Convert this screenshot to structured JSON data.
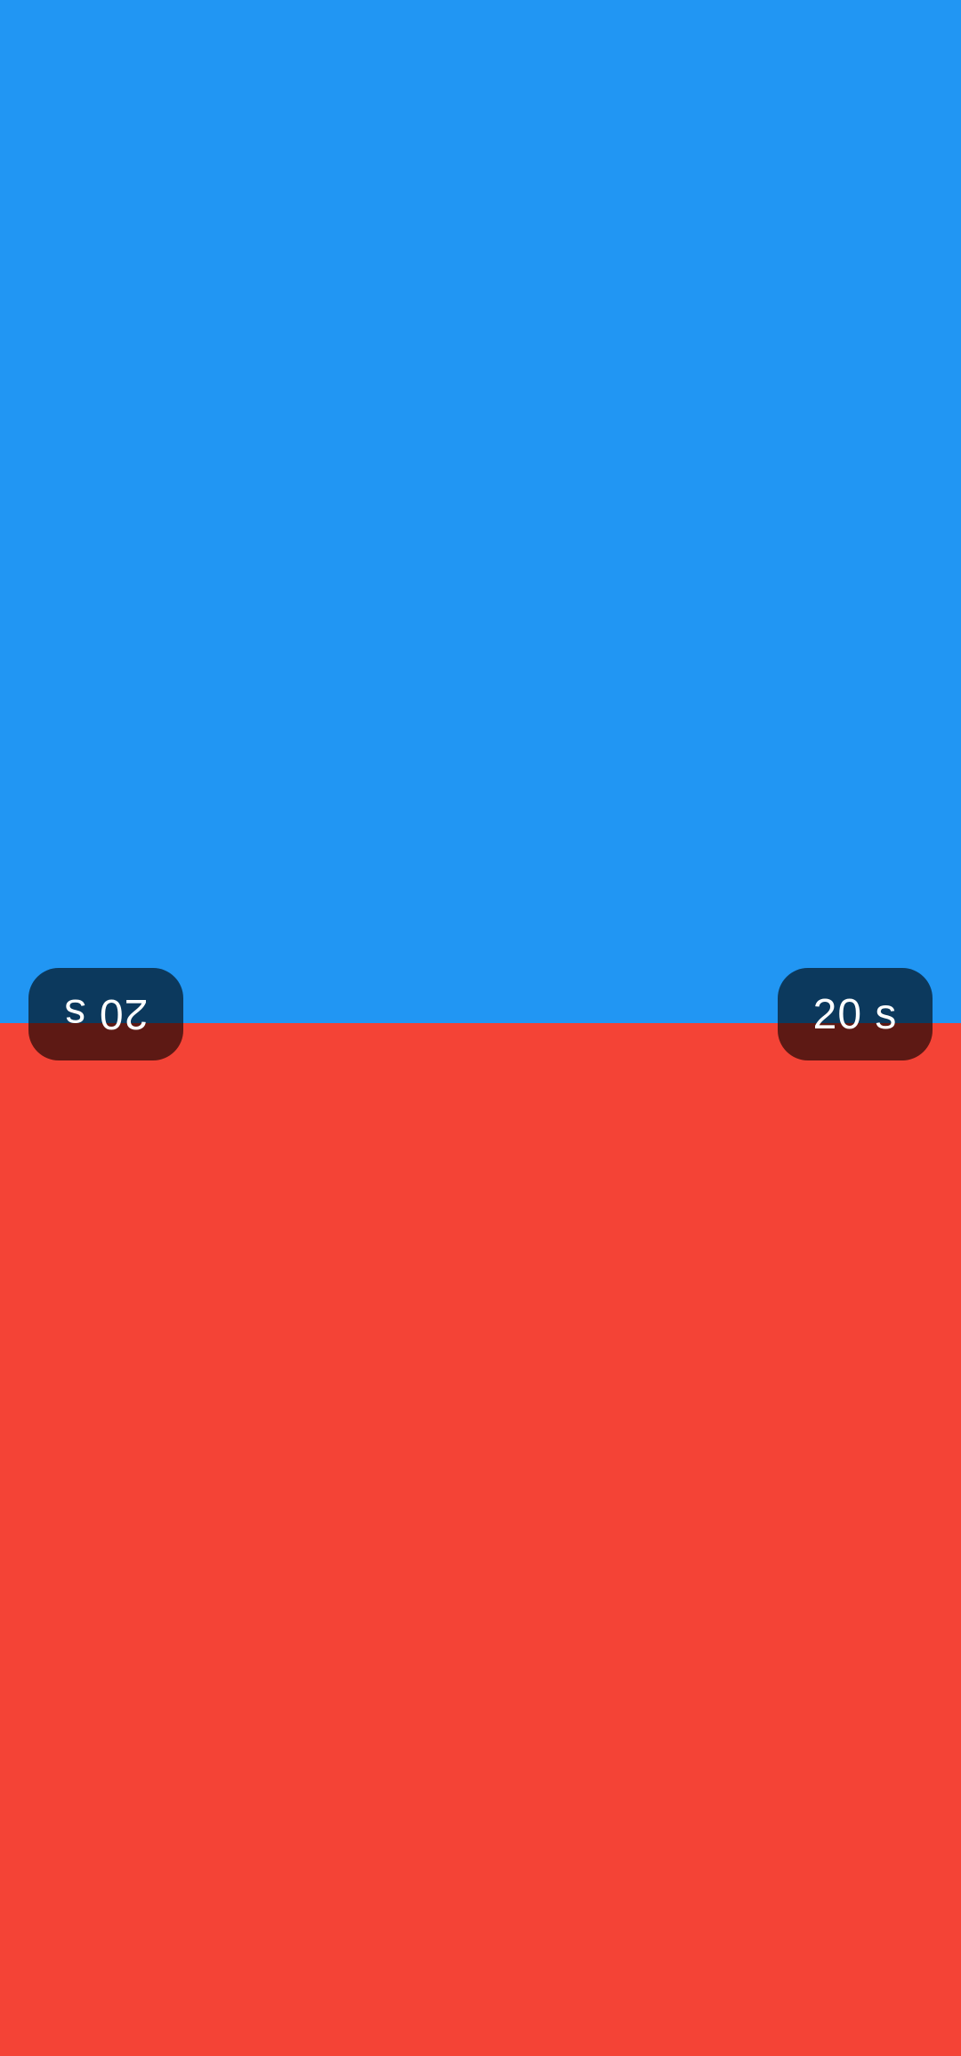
{
  "players": {
    "top": {
      "color": "#2196F3"
    },
    "bottom": {
      "color": "#F44336"
    }
  },
  "timers": {
    "top": "20 s",
    "bottom": "20 s"
  }
}
